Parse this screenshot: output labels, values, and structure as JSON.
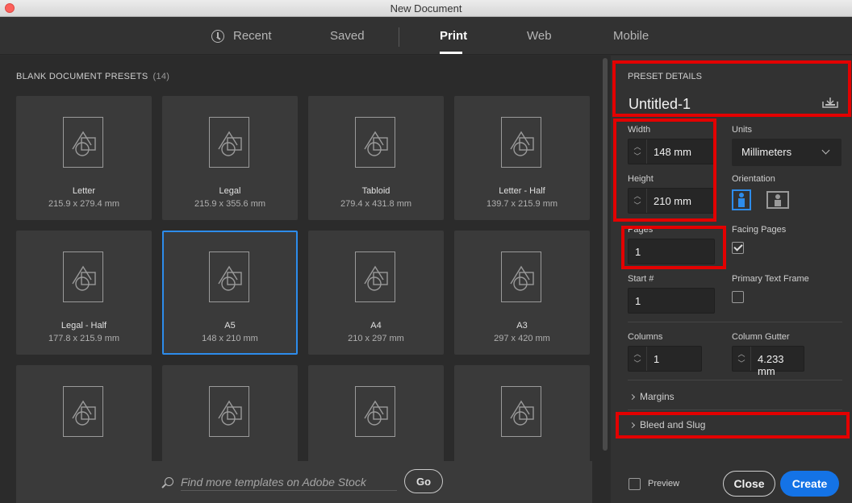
{
  "window": {
    "title": "New Document"
  },
  "tabs": [
    {
      "label": "Recent",
      "icon": "clock-icon"
    },
    {
      "label": "Saved"
    },
    {
      "label": "Print",
      "active": true
    },
    {
      "label": "Web"
    },
    {
      "label": "Mobile"
    }
  ],
  "presets": {
    "heading": "BLANK DOCUMENT PRESETS",
    "count": "(14)",
    "items": [
      {
        "name": "Letter",
        "dims": "215.9 x 279.4 mm"
      },
      {
        "name": "Legal",
        "dims": "215.9 x 355.6 mm"
      },
      {
        "name": "Tabloid",
        "dims": "279.4 x 431.8 mm"
      },
      {
        "name": "Letter - Half",
        "dims": "139.7 x 215.9 mm"
      },
      {
        "name": "Legal - Half",
        "dims": "177.8 x 215.9 mm"
      },
      {
        "name": "A5",
        "dims": "148 x 210 mm",
        "selected": true
      },
      {
        "name": "A4",
        "dims": "210 x 297 mm"
      },
      {
        "name": "A3",
        "dims": "297 x 420 mm"
      },
      {
        "name": "",
        "dims": ""
      },
      {
        "name": "",
        "dims": ""
      },
      {
        "name": "",
        "dims": ""
      },
      {
        "name": "",
        "dims": ""
      }
    ]
  },
  "search": {
    "placeholder": "Find more templates on Adobe Stock",
    "go_label": "Go"
  },
  "details": {
    "heading": "PRESET DETAILS",
    "title": "Untitled-1",
    "width_label": "Width",
    "width_value": "148 mm",
    "height_label": "Height",
    "height_value": "210 mm",
    "units_label": "Units",
    "units_value": "Millimeters",
    "orientation_label": "Orientation",
    "orientation": "portrait",
    "pages_label": "Pages",
    "pages_value": "1",
    "facing_label": "Facing Pages",
    "facing_checked": true,
    "start_label": "Start #",
    "start_value": "1",
    "primary_label": "Primary Text Frame",
    "primary_checked": false,
    "columns_label": "Columns",
    "columns_value": "1",
    "gutter_label": "Column Gutter",
    "gutter_value": "4.233 mm",
    "margins_label": "Margins",
    "bleed_label": "Bleed and Slug"
  },
  "footer": {
    "preview_label": "Preview",
    "close_label": "Close",
    "create_label": "Create"
  },
  "colors": {
    "accent": "#1473e6",
    "selection": "#2d8ceb",
    "highlight": "#e30000"
  }
}
